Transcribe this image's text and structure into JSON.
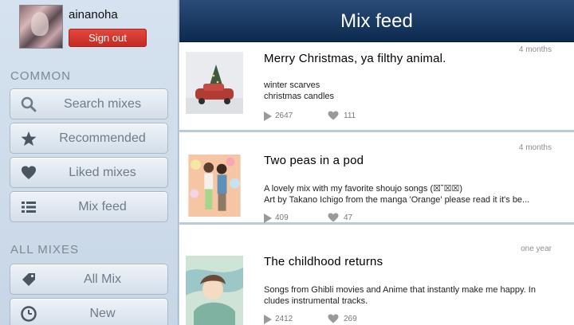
{
  "sidebar": {
    "username": "ainanoha",
    "signout_label": "Sign out",
    "sections": [
      {
        "label": "COMMON"
      },
      {
        "label": "ALL MIXES"
      }
    ],
    "common_items": [
      {
        "label": "Search mixes",
        "icon": "search-icon"
      },
      {
        "label": "Recommended",
        "icon": "star-icon"
      },
      {
        "label": "Liked mixes",
        "icon": "heart-icon"
      },
      {
        "label": "Mix feed",
        "icon": "list-icon"
      }
    ],
    "all_items": [
      {
        "label": "All Mix",
        "icon": "tag-icon"
      },
      {
        "label": "New",
        "icon": "clock-icon"
      }
    ]
  },
  "header": {
    "title": "Mix feed"
  },
  "feed": [
    {
      "title": "Merry Christmas, ya filthy animal.",
      "age": "4 months",
      "description_lines": [
        "winter scarves",
        "christmas candles"
      ],
      "plays": "2647",
      "likes": "111"
    },
    {
      "title": "Two peas in a pod",
      "age": "4 months",
      "description_lines": [
        "A lovely mix with my favorite shoujo songs (☒˘☒☒)",
        "Art by Takano Ichigo from the manga 'Orange' please read it it's be..."
      ],
      "plays": "409",
      "likes": "47"
    },
    {
      "title": "The childhood returns",
      "age": "one year",
      "description_lines": [
        "Songs from Ghibli movies and Anime that instantly make me happy. In",
        "cludes instrumental tracks."
      ],
      "plays": "2412",
      "likes": "269"
    }
  ],
  "colors": {
    "header_bg": "#0d2a4f",
    "signout_bg": "#c52b22",
    "sidebar_bg": "#d6e2ef"
  }
}
